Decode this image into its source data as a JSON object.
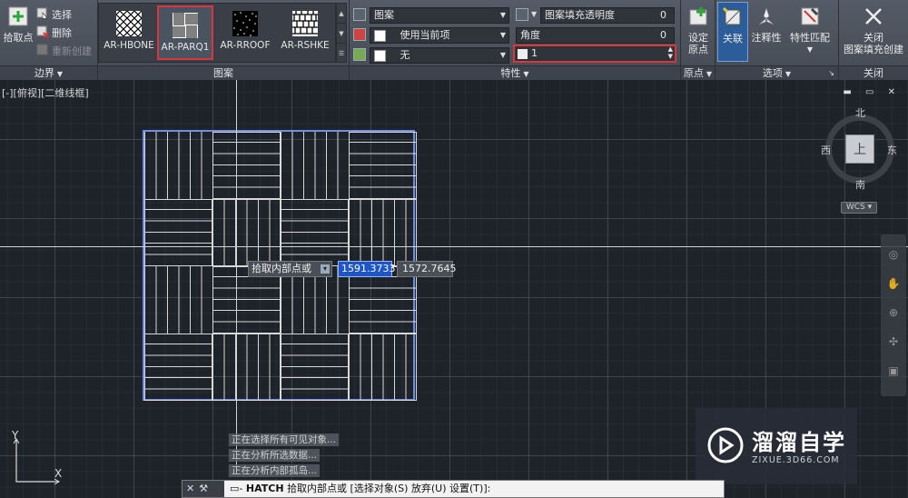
{
  "ribbon": {
    "boundary": {
      "pick_point": "拾取点",
      "select": "选择",
      "remove": "删除",
      "recreate": "重新创建",
      "panel_label": "边界"
    },
    "pattern": {
      "panel_label": "图案",
      "swatches": [
        {
          "name": "AR-HBONE",
          "selected": false
        },
        {
          "name": "AR-PARQ1",
          "selected": true
        },
        {
          "name": "AR-RROOF",
          "selected": false
        },
        {
          "name": "AR-RSHKE",
          "selected": false
        }
      ]
    },
    "properties": {
      "panel_label": "特性",
      "hatch_type": "图案",
      "color": "使用当前项",
      "background": "无",
      "transparency_label": "图案填充透明度",
      "transparency_value": "0",
      "angle_label": "角度",
      "angle_value": "0",
      "scale_value": "1"
    },
    "origin": {
      "set_origin_line1": "设定",
      "set_origin_line2": "原点",
      "panel_label": "原点"
    },
    "options": {
      "associative": "关联",
      "annotative": "注释性",
      "match_properties": "特性匹配",
      "panel_label": "选项"
    },
    "close": {
      "line1": "关闭",
      "line2": "图案填充创建",
      "panel_label": "关闭"
    }
  },
  "viewport": {
    "label": "[-][俯视][二维线框]",
    "viewcube": {
      "north": "北",
      "south": "南",
      "west": "西",
      "east": "东",
      "top": "上",
      "wcs": "WCS ▾"
    },
    "ucs": {
      "x": "X",
      "y": "Y"
    },
    "cursor_prompt": "拾取内部点或",
    "cursor_x": "1591.3733",
    "cursor_y": "1572.7645"
  },
  "history": [
    "正在选择所有可见对象...",
    "正在分析所选数据...",
    "正在分析内部孤岛..."
  ],
  "command": {
    "name": "HATCH",
    "prompt": "拾取内部点或",
    "options": "[选择对象(S) 放弃(U) 设置(T)]:"
  },
  "watermark": {
    "title": "溜溜自学",
    "sub": "ZIXUE.3D66.COM"
  },
  "colors": {
    "ribbon": "#4d535c",
    "viewport": "#1e2229",
    "hatch_boundary": "#6f8ee8",
    "highlight": "#d9363e",
    "cursor_x_field": "#1e56c8"
  }
}
